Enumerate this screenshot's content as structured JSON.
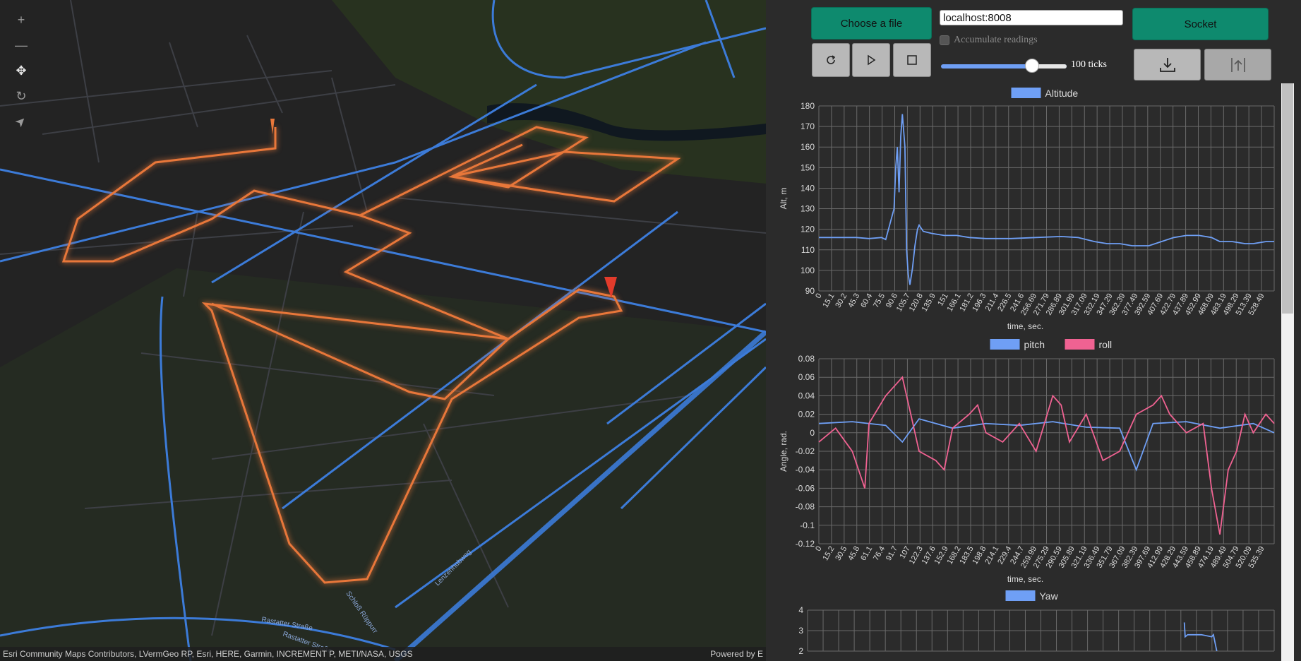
{
  "map": {
    "tools": [
      {
        "name": "zoom-in",
        "glyph": "+"
      },
      {
        "name": "zoom-out",
        "glyph": "—"
      },
      {
        "name": "pan",
        "glyph": "✥"
      },
      {
        "name": "rotate",
        "glyph": "↻"
      },
      {
        "name": "compass",
        "glyph": "➤"
      }
    ],
    "streets": [
      "Rastatter Straße",
      "Rastatter Straße",
      "Schloß Rüppurr",
      "Lenzenhubweg"
    ],
    "attribution": "Esri Community Maps Contributors, LVermGeo RP, Esri, HERE, Garmin, INCREMENT P, METI/NASA, USGS",
    "powered_by": "Powered by E",
    "colors": {
      "route": "#e8773a",
      "road": "#3c7bd8",
      "marker": "#e23b2b"
    }
  },
  "controls": {
    "choose_file_label": "Choose a file",
    "url_value": "localhost:8008",
    "socket_label": "Socket",
    "accumulate_label": "Accumulate readings",
    "ticks_label": "100 ticks",
    "slider_fraction": 0.72,
    "icons": [
      "refresh-icon",
      "play-icon",
      "stop-icon",
      "download-icon",
      "upload-icon"
    ]
  },
  "chart_data": [
    {
      "type": "line",
      "title": "",
      "legend": [
        "Altitude"
      ],
      "xlabel": "time, sec.",
      "ylabel": "Alt, m",
      "ylim": [
        90,
        180
      ],
      "yticks": [
        90,
        100,
        110,
        120,
        130,
        140,
        150,
        160,
        170,
        180
      ],
      "xticks": [
        "0",
        "15.1",
        "30.2",
        "45.3",
        "60.4",
        "75.5",
        "90.6",
        "105.7",
        "120.8",
        "135.9",
        "151",
        "166.1",
        "181.2",
        "196.3",
        "211.4",
        "226.5",
        "241.6",
        "256.69",
        "271.79",
        "286.89",
        "301.99",
        "317.09",
        "332.19",
        "347.29",
        "362.39",
        "377.49",
        "392.59",
        "407.69",
        "422.79",
        "437.89",
        "452.99",
        "468.09",
        "483.19",
        "498.29",
        "513.39",
        "528.49"
      ],
      "series": [
        {
          "name": "Altitude",
          "color": "#6f9ff5",
          "points": [
            [
              0,
              116
            ],
            [
              15,
              116
            ],
            [
              30,
              116
            ],
            [
              45,
              116
            ],
            [
              60,
              115.5
            ],
            [
              75,
              116
            ],
            [
              80,
              115
            ],
            [
              90,
              130
            ],
            [
              92,
              150
            ],
            [
              94,
              160
            ],
            [
              96,
              138
            ],
            [
              98,
              165
            ],
            [
              100,
              176
            ],
            [
              103,
              160
            ],
            [
              105,
              110
            ],
            [
              107,
              98
            ],
            [
              109,
              93
            ],
            [
              112,
              101
            ],
            [
              115,
              112
            ],
            [
              118,
              120
            ],
            [
              120,
              122
            ],
            [
              125,
              119
            ],
            [
              135,
              118
            ],
            [
              150,
              117
            ],
            [
              165,
              117
            ],
            [
              180,
              116
            ],
            [
              200,
              115.5
            ],
            [
              230,
              115.5
            ],
            [
              260,
              116
            ],
            [
              290,
              116.5
            ],
            [
              310,
              116
            ],
            [
              330,
              114
            ],
            [
              345,
              113
            ],
            [
              360,
              113
            ],
            [
              375,
              112
            ],
            [
              395,
              112
            ],
            [
              410,
              114
            ],
            [
              425,
              116
            ],
            [
              440,
              117
            ],
            [
              455,
              117
            ],
            [
              470,
              116
            ],
            [
              480,
              114
            ],
            [
              495,
              114
            ],
            [
              510,
              113
            ],
            [
              520,
              113
            ],
            [
              535,
              114
            ],
            [
              545,
              114
            ]
          ]
        }
      ]
    },
    {
      "type": "line",
      "title": "",
      "legend": [
        "pitch",
        "roll"
      ],
      "xlabel": "time, sec.",
      "ylabel": "Angle, rad.",
      "ylim": [
        -0.12,
        0.08
      ],
      "yticks": [
        -0.12,
        -0.1,
        -0.08,
        -0.06,
        -0.04,
        -0.02,
        0,
        0.02,
        0.04,
        0.06,
        0.08
      ],
      "xticks": [
        "0",
        "15.2",
        "30.5",
        "45.8",
        "61.1",
        "76.4",
        "91.7",
        "107",
        "122.3",
        "137.6",
        "152.9",
        "168.2",
        "183.5",
        "198.8",
        "214.1",
        "229.4",
        "244.7",
        "259.99",
        "275.29",
        "290.59",
        "305.89",
        "321.19",
        "336.49",
        "351.79",
        "367.09",
        "382.39",
        "397.69",
        "412.99",
        "428.29",
        "443.59",
        "458.89",
        "474.19",
        "489.49",
        "504.79",
        "520.09",
        "535.39"
      ],
      "series": [
        {
          "name": "pitch",
          "color": "#6f9ff5",
          "points": [
            [
              0,
              0.01
            ],
            [
              40,
              0.012
            ],
            [
              80,
              0.008
            ],
            [
              100,
              -0.01
            ],
            [
              120,
              0.015
            ],
            [
              160,
              0.005
            ],
            [
              200,
              0.01
            ],
            [
              240,
              0.008
            ],
            [
              280,
              0.012
            ],
            [
              320,
              0.006
            ],
            [
              360,
              0.005
            ],
            [
              380,
              -0.04
            ],
            [
              400,
              0.01
            ],
            [
              440,
              0.012
            ],
            [
              480,
              0.005
            ],
            [
              520,
              0.01
            ],
            [
              545,
              0.0
            ]
          ]
        },
        {
          "name": "roll",
          "color": "#f06292",
          "points": [
            [
              0,
              -0.01
            ],
            [
              20,
              0.005
            ],
            [
              40,
              -0.02
            ],
            [
              55,
              -0.06
            ],
            [
              60,
              0.01
            ],
            [
              80,
              0.04
            ],
            [
              90,
              0.05
            ],
            [
              100,
              0.06
            ],
            [
              110,
              0.02
            ],
            [
              120,
              -0.02
            ],
            [
              140,
              -0.03
            ],
            [
              150,
              -0.04
            ],
            [
              160,
              0.005
            ],
            [
              180,
              0.02
            ],
            [
              190,
              0.03
            ],
            [
              200,
              0.0
            ],
            [
              220,
              -0.01
            ],
            [
              240,
              0.01
            ],
            [
              260,
              -0.02
            ],
            [
              280,
              0.04
            ],
            [
              290,
              0.03
            ],
            [
              300,
              -0.01
            ],
            [
              320,
              0.02
            ],
            [
              340,
              -0.03
            ],
            [
              360,
              -0.02
            ],
            [
              380,
              0.02
            ],
            [
              400,
              0.03
            ],
            [
              410,
              0.04
            ],
            [
              420,
              0.02
            ],
            [
              440,
              0.0
            ],
            [
              460,
              0.01
            ],
            [
              470,
              -0.06
            ],
            [
              480,
              -0.11
            ],
            [
              490,
              -0.04
            ],
            [
              500,
              -0.02
            ],
            [
              510,
              0.02
            ],
            [
              520,
              0.0
            ],
            [
              535,
              0.02
            ],
            [
              545,
              0.01
            ]
          ]
        }
      ]
    },
    {
      "type": "line",
      "title": "",
      "legend": [
        "Yaw"
      ],
      "xlabel": "",
      "ylabel": "",
      "ylim": [
        2,
        4
      ],
      "yticks": [
        2,
        3,
        4
      ],
      "xticks": [],
      "series": [
        {
          "name": "Yaw",
          "color": "#6f9ff5",
          "points": [
            [
              440,
              3.4
            ],
            [
              441,
              2.7
            ],
            [
              444,
              2.8
            ],
            [
              460,
              2.8
            ],
            [
              472,
              2.7
            ],
            [
              474,
              2.8
            ],
            [
              478,
              2.0
            ]
          ]
        }
      ]
    }
  ]
}
